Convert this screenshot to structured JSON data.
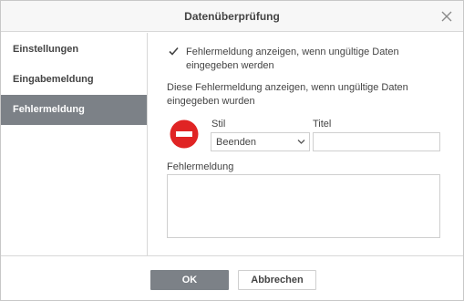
{
  "dialog": {
    "title": "Datenüberprüfung"
  },
  "sidebar": {
    "items": [
      {
        "label": "Einstellungen",
        "active": false
      },
      {
        "label": "Eingabemeldung",
        "active": false
      },
      {
        "label": "Fehlermeldung",
        "active": true
      }
    ]
  },
  "main": {
    "show_error_checkbox": {
      "checked": true,
      "label": "Fehlermeldung anzeigen, wenn ungültige Daten eingegeben werden"
    },
    "description": "Diese Fehlermeldung anzeigen, wenn ungültige Daten eingegeben wurden",
    "style": {
      "label": "Stil",
      "value": "Beenden",
      "icon": "stop-icon"
    },
    "title_field": {
      "label": "Titel",
      "value": ""
    },
    "error_message": {
      "label": "Fehlermeldung",
      "value": ""
    }
  },
  "footer": {
    "ok_label": "OK",
    "cancel_label": "Abbrechen"
  },
  "colors": {
    "accent": "#7c8187",
    "stop_red": "#e02424"
  }
}
